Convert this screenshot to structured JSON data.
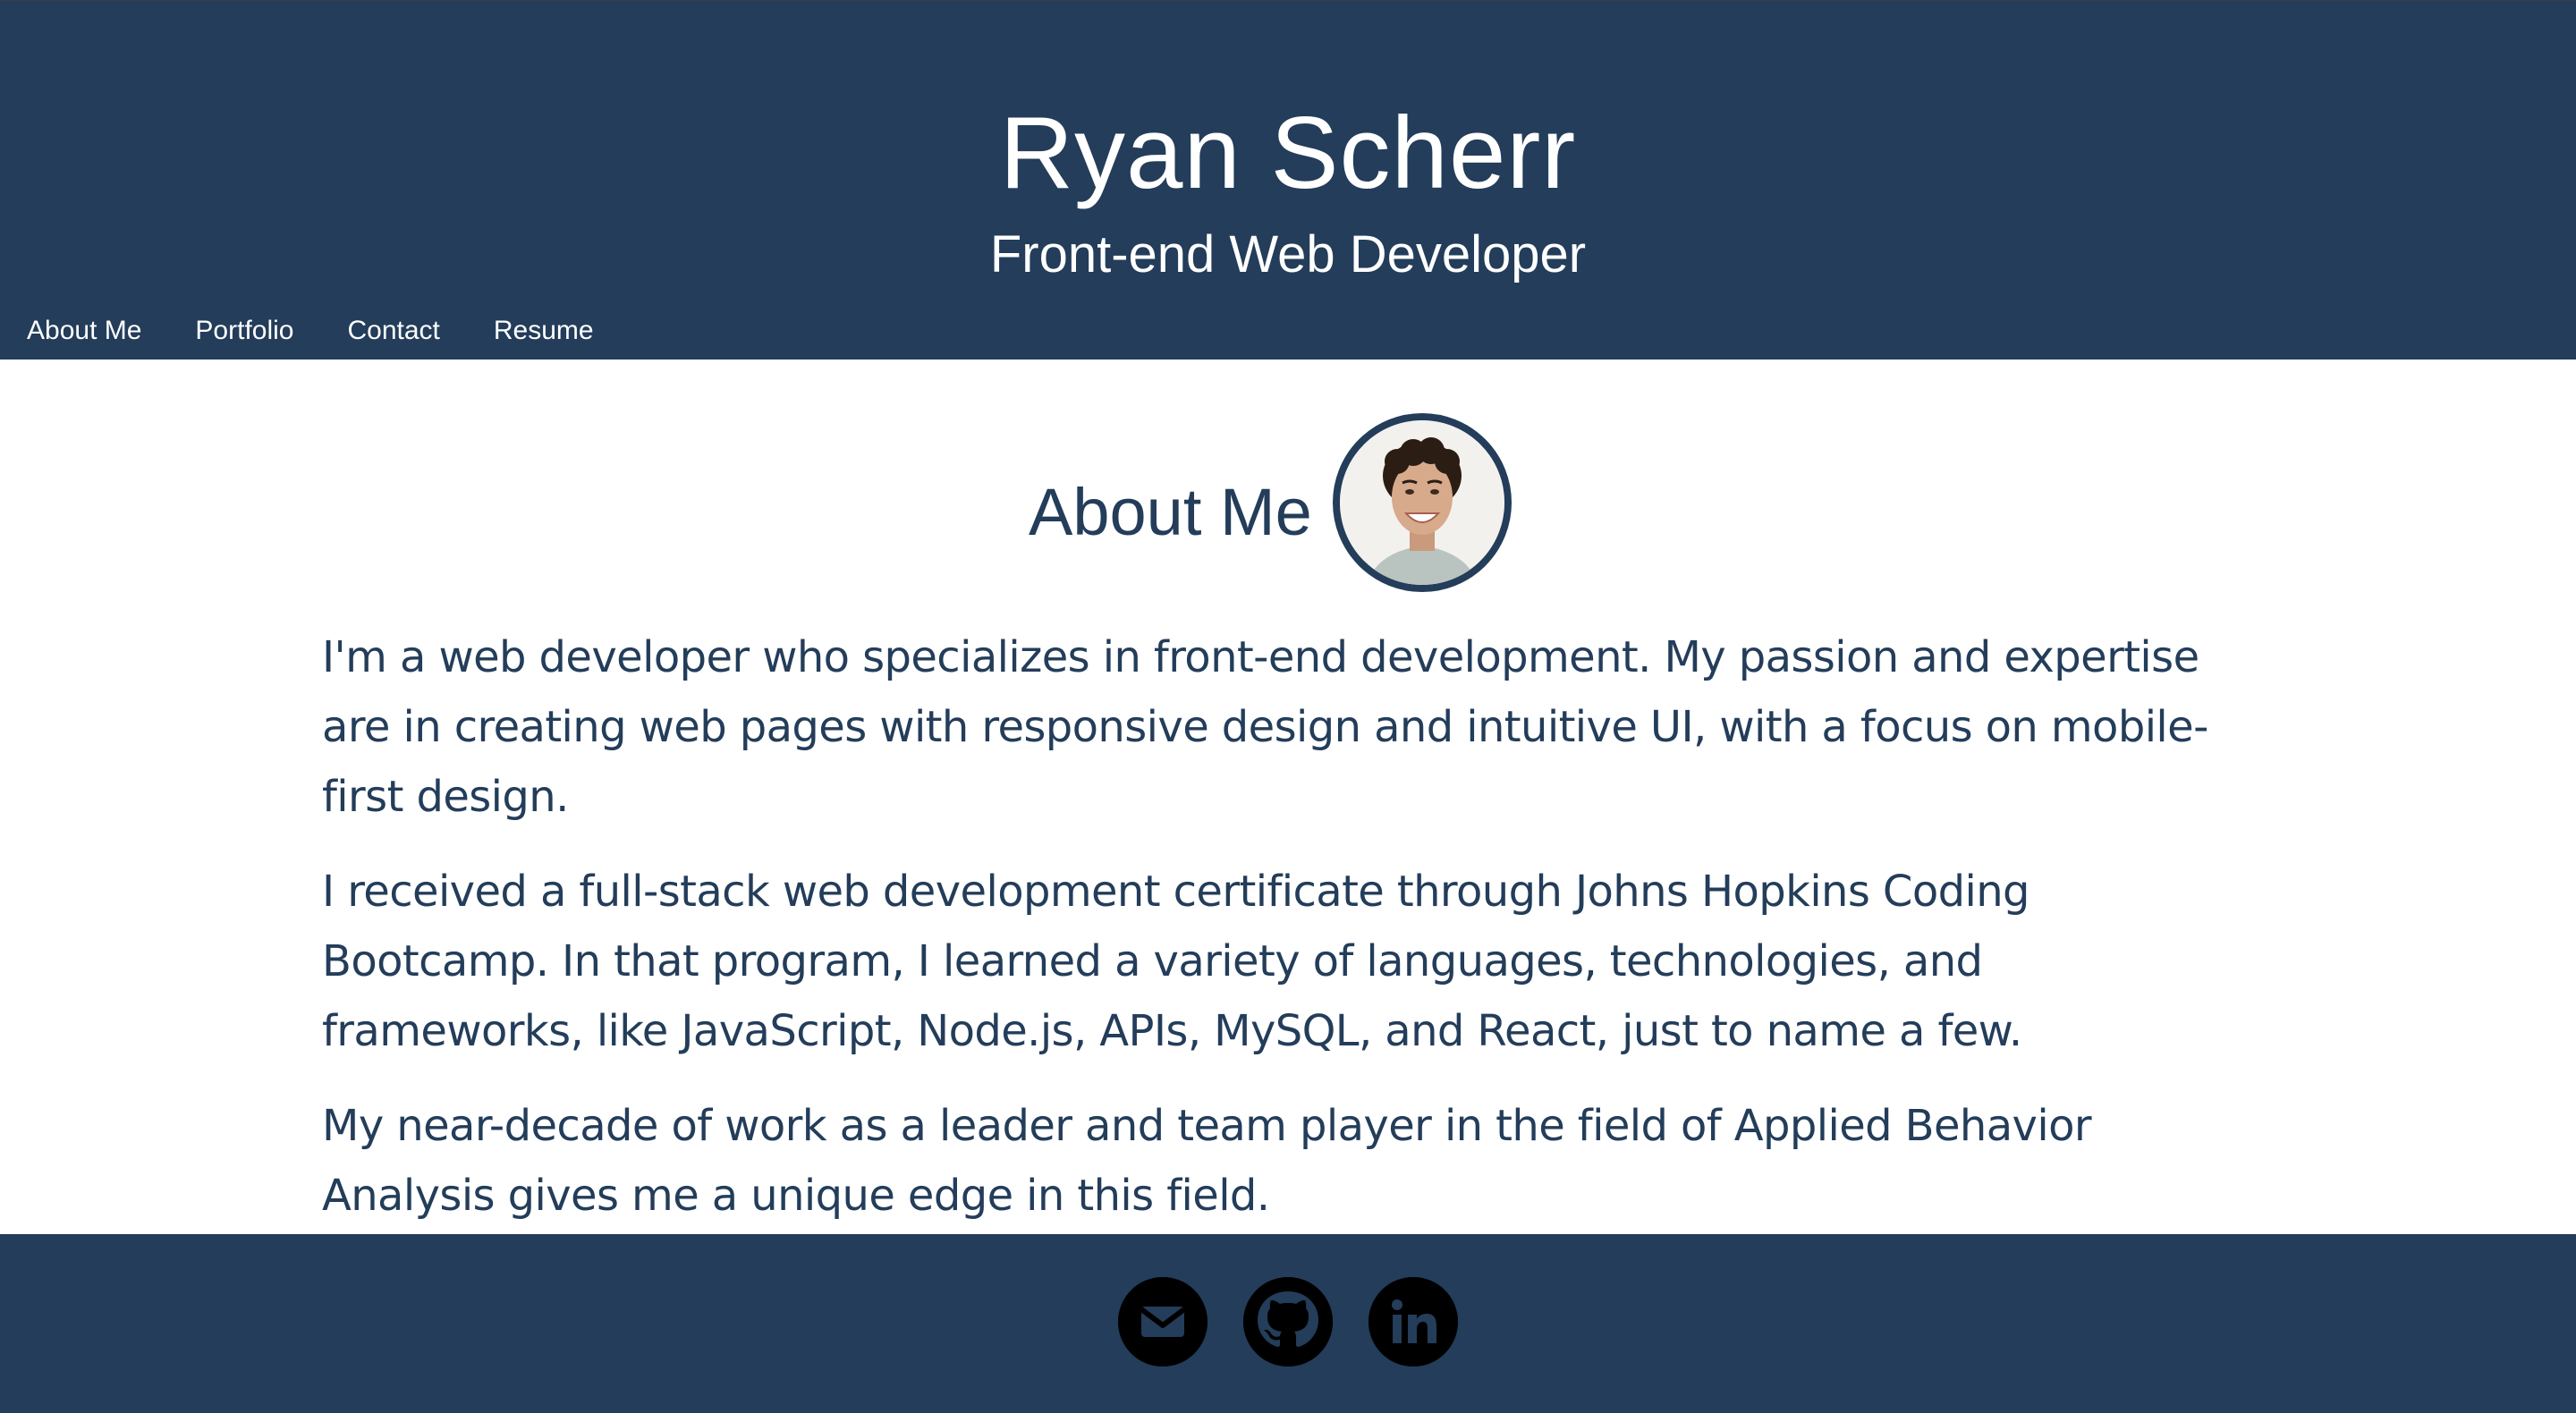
{
  "header": {
    "title": "Ryan Scherr",
    "subtitle": "Front-end Web Developer"
  },
  "nav": {
    "items": [
      {
        "label": "About Me"
      },
      {
        "label": "Portfolio"
      },
      {
        "label": "Contact"
      },
      {
        "label": "Resume"
      }
    ]
  },
  "about": {
    "heading": "About Me",
    "avatar_icon": "profile-photo",
    "paragraphs": [
      "I'm a web developer who specializes in front-end development. My passion and expertise are in creating web pages with responsive design and intuitive UI, with a focus on mobile-first design.",
      "I received a full-stack web development certificate through Johns Hopkins Coding Bootcamp. In that program, I learned a variety of languages, technologies, and frameworks, like JavaScript, Node.js, APIs, MySQL, and React, just to name a few.",
      "My near-decade of work as a leader and team player in the field of Applied Behavior Analysis gives me a unique edge in this field."
    ]
  },
  "footer": {
    "links": [
      {
        "icon": "email-icon"
      },
      {
        "icon": "github-icon"
      },
      {
        "icon": "linkedin-icon"
      }
    ]
  },
  "colors": {
    "primary": "#233d5a",
    "background": "#ffffff",
    "icon": "#000000"
  }
}
